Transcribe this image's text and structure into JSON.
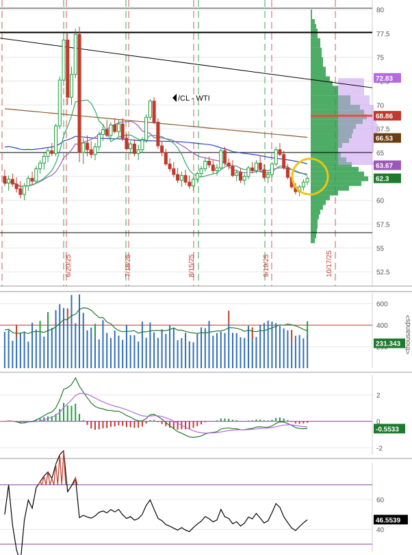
{
  "chart_data": [
    {
      "type": "candlestick",
      "title": "/CL - WTI",
      "x_date_labels": [
        "6/20/25",
        "7/18/25",
        "8/15/25",
        "9/19/25",
        "10/17/25"
      ],
      "ylim": [
        51,
        81
      ],
      "y_ticks": [
        52.5,
        55,
        57.5,
        60,
        62.5,
        65,
        67.5,
        70,
        72.5,
        75,
        77.5,
        80
      ],
      "price_badges": [
        {
          "label": "72.83",
          "value": 72.83,
          "color": "#b36ae2"
        },
        {
          "label": "68.86",
          "value": 68.86,
          "color": "#c0392b"
        },
        {
          "label": "66.53",
          "value": 66.53,
          "color": "#6b3e12"
        },
        {
          "label": "63.67",
          "value": 63.67,
          "color": "#9b59b6"
        },
        {
          "label": "62.3",
          "value": 62.3,
          "color": "#1e7a2e"
        }
      ],
      "horizontal_levels": [
        77.6,
        65.0,
        56.6
      ],
      "trendline": {
        "start": 77.0,
        "end": 71.8
      },
      "candles": [
        [
          62.5,
          63.2,
          61.5,
          61.8
        ],
        [
          61.8,
          62.6,
          61.0,
          62.2
        ],
        [
          62.2,
          62.8,
          61.4,
          61.7
        ],
        [
          61.7,
          62.4,
          60.8,
          61.2
        ],
        [
          61.2,
          62.0,
          60.2,
          60.6
        ],
        [
          60.6,
          61.8,
          60.0,
          61.5
        ],
        [
          61.5,
          62.6,
          61.0,
          62.3
        ],
        [
          62.3,
          63.0,
          61.6,
          62.0
        ],
        [
          62.0,
          63.6,
          61.8,
          63.3
        ],
        [
          63.3,
          64.2,
          62.8,
          63.9
        ],
        [
          63.9,
          65.0,
          63.2,
          64.6
        ],
        [
          64.6,
          65.5,
          64.0,
          65.2
        ],
        [
          65.2,
          66.0,
          64.6,
          64.9
        ],
        [
          64.9,
          68.0,
          64.6,
          67.8
        ],
        [
          67.8,
          73.0,
          67.5,
          72.6
        ],
        [
          72.6,
          77.5,
          72.0,
          76.8
        ],
        [
          76.8,
          77.5,
          70.0,
          70.8
        ],
        [
          70.8,
          74.0,
          70.0,
          73.2
        ],
        [
          73.2,
          78.0,
          72.8,
          77.4
        ],
        [
          77.4,
          78.2,
          64.0,
          65.0
        ],
        [
          65.0,
          66.5,
          63.8,
          66.0
        ],
        [
          66.0,
          66.8,
          64.6,
          65.3
        ],
        [
          65.3,
          66.2,
          64.4,
          64.8
        ],
        [
          64.8,
          66.0,
          64.2,
          65.6
        ],
        [
          65.6,
          67.2,
          65.2,
          66.9
        ],
        [
          66.9,
          68.0,
          66.2,
          67.4
        ],
        [
          67.4,
          68.4,
          66.6,
          66.8
        ],
        [
          66.8,
          68.2,
          66.4,
          67.9
        ],
        [
          67.9,
          68.6,
          67.0,
          67.2
        ],
        [
          67.2,
          68.4,
          66.6,
          68.0
        ],
        [
          68.0,
          68.6,
          66.2,
          66.5
        ],
        [
          66.5,
          67.0,
          65.2,
          65.4
        ],
        [
          65.4,
          66.2,
          64.8,
          65.9
        ],
        [
          65.9,
          66.4,
          64.6,
          64.9
        ],
        [
          64.9,
          65.8,
          64.2,
          65.3
        ],
        [
          65.3,
          66.6,
          65.0,
          66.3
        ],
        [
          66.3,
          69.0,
          66.0,
          68.7
        ],
        [
          68.7,
          70.6,
          68.4,
          70.4
        ],
        [
          70.4,
          70.8,
          68.0,
          68.2
        ],
        [
          68.2,
          68.6,
          65.4,
          65.7
        ],
        [
          65.7,
          66.2,
          64.6,
          65.0
        ],
        [
          65.0,
          65.4,
          63.6,
          63.8
        ],
        [
          63.8,
          64.4,
          63.0,
          63.3
        ],
        [
          63.3,
          64.0,
          62.4,
          62.7
        ],
        [
          62.7,
          63.4,
          61.8,
          62.1
        ],
        [
          62.1,
          63.0,
          61.4,
          62.6
        ],
        [
          62.6,
          63.2,
          61.6,
          61.9
        ],
        [
          61.9,
          62.6,
          61.2,
          61.5
        ],
        [
          61.5,
          62.4,
          61.0,
          62.2
        ],
        [
          62.2,
          63.0,
          61.8,
          62.8
        ],
        [
          62.8,
          63.6,
          62.4,
          63.3
        ],
        [
          63.3,
          64.4,
          63.0,
          64.1
        ],
        [
          64.1,
          64.6,
          63.4,
          63.7
        ],
        [
          63.7,
          64.2,
          62.8,
          63.1
        ],
        [
          63.1,
          63.8,
          62.6,
          63.4
        ],
        [
          63.4,
          65.4,
          63.2,
          65.2
        ],
        [
          65.2,
          65.6,
          63.6,
          63.9
        ],
        [
          63.9,
          64.4,
          63.2,
          63.6
        ],
        [
          63.6,
          64.2,
          62.4,
          62.6
        ],
        [
          62.6,
          63.2,
          62.0,
          62.9
        ],
        [
          62.9,
          63.4,
          61.8,
          62.1
        ],
        [
          62.1,
          62.8,
          61.6,
          62.5
        ],
        [
          62.5,
          63.6,
          62.2,
          63.4
        ],
        [
          63.4,
          64.0,
          62.8,
          63.1
        ],
        [
          63.1,
          64.2,
          62.8,
          63.9
        ],
        [
          63.9,
          64.6,
          63.0,
          63.2
        ],
        [
          63.2,
          63.8,
          62.2,
          62.4
        ],
        [
          62.4,
          63.0,
          61.8,
          62.7
        ],
        [
          62.7,
          64.0,
          62.4,
          63.8
        ],
        [
          63.8,
          65.6,
          63.6,
          65.3
        ],
        [
          65.3,
          66.0,
          64.6,
          64.8
        ],
        [
          64.8,
          65.2,
          63.2,
          63.4
        ],
        [
          63.4,
          63.8,
          62.2,
          62.4
        ],
        [
          62.4,
          62.8,
          61.2,
          61.4
        ],
        [
          61.4,
          61.8,
          60.6,
          60.9
        ],
        [
          60.9,
          61.6,
          60.4,
          61.4
        ],
        [
          61.4,
          62.2,
          61.0,
          61.9
        ],
        [
          61.9,
          62.5,
          61.6,
          62.3
        ]
      ],
      "series": [
        {
          "name": "",
          "color": "#8b5a2b",
          "start": 69.6,
          "end": 66.6
        },
        {
          "name": "",
          "color": "#2a44b8",
          "start": 68.1,
          "end": 64.2
        },
        {
          "name": "",
          "color": "#9b59b6",
          "start": 63.0,
          "end": 63.7
        },
        {
          "name": "",
          "color": "#27ae60",
          "start": 61.8,
          "end": 62.3
        }
      ],
      "volume_profile_ticks": "52.5–80 price-by-volume histogram"
    },
    {
      "type": "bar",
      "ylim": [
        0,
        700
      ],
      "y_ticks": [
        200,
        400,
        600
      ],
      "reference_level": 400,
      "badge": {
        "label": "231.343",
        "value": 231.343
      },
      "unit_label": "<thousands>"
    },
    {
      "type": "line",
      "ylim": [
        -2.5,
        3.5
      ],
      "y_ticks": [
        -2,
        0,
        2
      ],
      "badge": {
        "label": "-0.5533",
        "value": -0.5533
      },
      "zero_level": 0
    },
    {
      "type": "line",
      "ylim": [
        25,
        85
      ],
      "y_ticks": [
        40,
        60
      ],
      "levels": [
        70,
        30
      ],
      "badge": {
        "label": "46.5539",
        "value": 46.5539
      }
    }
  ],
  "colors": {
    "up": "#1a9e3a",
    "down": "#c0392b",
    "profile_green": "#2e9d4a",
    "profile_purple": "#c9a4f0",
    "grid": "#e6e6e6",
    "ref_red": "#c0392b",
    "ref_purple": "#8e44ad"
  }
}
